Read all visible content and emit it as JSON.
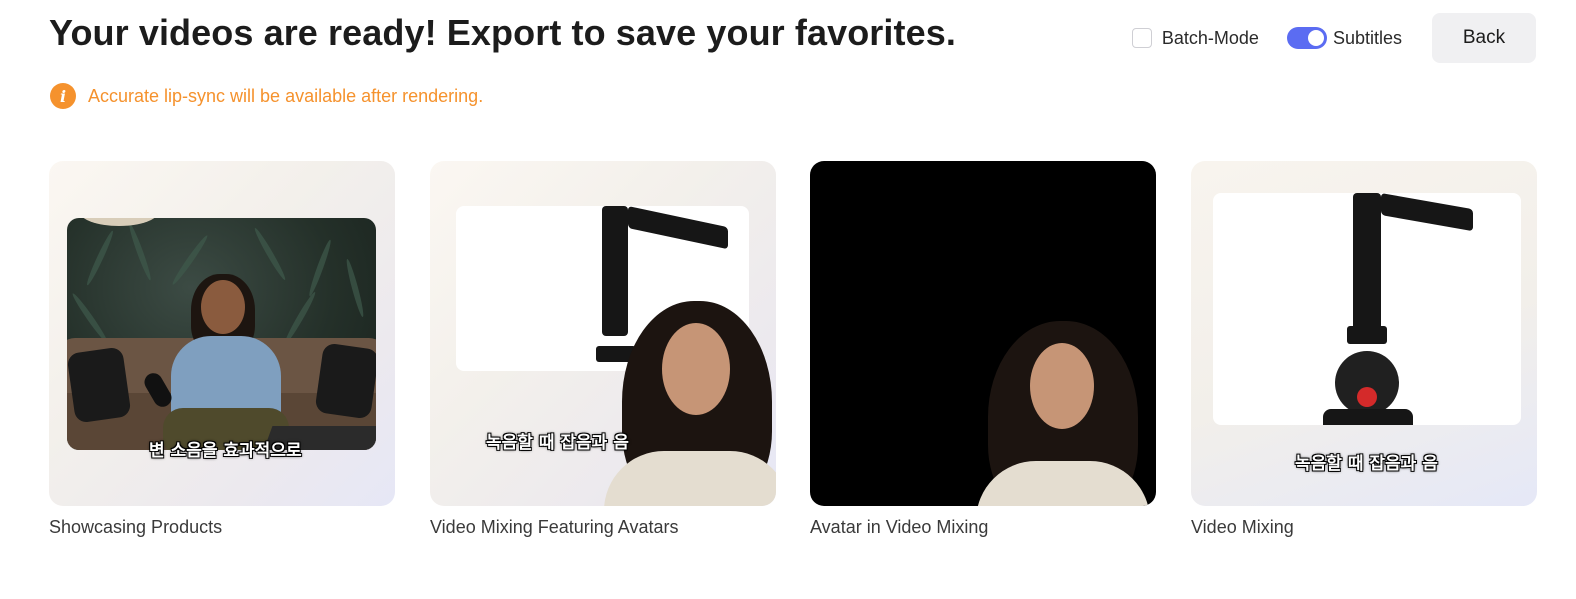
{
  "header": {
    "title": "Your videos are ready! Export to save your favorites."
  },
  "controls": {
    "batch_mode_label": "Batch-Mode",
    "batch_mode_checked": false,
    "subtitles_label": "Subtitles",
    "subtitles_on": true,
    "back_label": "Back"
  },
  "notice": {
    "icon": "info-icon",
    "text": "Accurate lip-sync will be available after rendering."
  },
  "videos": [
    {
      "title": "Showcasing Products",
      "subtitle": "변 소음을 효과적으로"
    },
    {
      "title": "Video Mixing Featuring Avatars",
      "subtitle": "녹음할 때 잡음과 음"
    },
    {
      "title": "Avatar in Video Mixing",
      "subtitle": ""
    },
    {
      "title": "Video Mixing",
      "subtitle": "녹음할 때 잡음과 음"
    }
  ],
  "colors": {
    "accent": "#5b6cf2",
    "warning": "#f5922d",
    "title_text": "#1c1c1c",
    "button_bg": "#f0f0f2"
  }
}
